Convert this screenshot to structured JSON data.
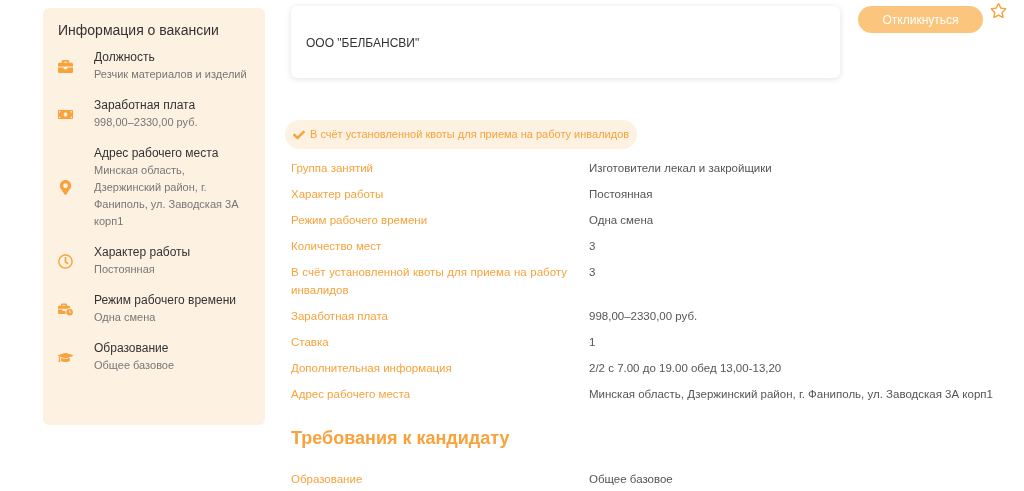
{
  "sidebar": {
    "title": "Информация о вакансии",
    "items": [
      {
        "kind": "briefcase",
        "label": "Должность",
        "value": "Резчик материалов и изделий"
      },
      {
        "kind": "money",
        "label": "Заработная плата",
        "value": "998,00–2330,00 руб."
      },
      {
        "kind": "location",
        "label": "Адрес рабочего места",
        "value": "Минская область, Дзержинский район, г. Фаниполь, ул. Заводская 3А корп1"
      },
      {
        "kind": "clock",
        "label": "Характер работы",
        "value": "Постоянная"
      },
      {
        "kind": "schedule",
        "label": "Режим рабочего времени",
        "value": "Одна смена"
      },
      {
        "kind": "education",
        "label": "Образование",
        "value": "Общее базовое"
      }
    ]
  },
  "employer": {
    "name": "ООО \"БЕЛБАНСВИ\""
  },
  "apply_button": "Откликнуться",
  "quota_badge": "В счёт установленной квоты для приема на работу инвалидов",
  "details": [
    {
      "label": "Группа занятий",
      "value": "Изготовители лекал и закройщики"
    },
    {
      "label": "Характер работы",
      "value": "Постоянная"
    },
    {
      "label": "Режим рабочего времени",
      "value": "Одна смена"
    },
    {
      "label": "Количество мест",
      "value": "3"
    },
    {
      "label": "В счёт установленной квоты для приема на работу инвалидов",
      "value": "3"
    },
    {
      "label": "Заработная плата",
      "value": "998,00–2330,00 руб."
    },
    {
      "label": "Ставка",
      "value": "1"
    },
    {
      "label": "Дополнительная информация",
      "value": "2/2 с 7.00 до 19.00 обед 13,00-13,20"
    },
    {
      "label": "Адрес рабочего места",
      "value": "Минская область, Дзержинский район, г. Фаниполь, ул. Заводская 3А корп1"
    }
  ],
  "requirements": {
    "title": "Требования к кандидату",
    "rows": [
      {
        "label": "Образование",
        "value": "Общее базовое"
      }
    ]
  }
}
